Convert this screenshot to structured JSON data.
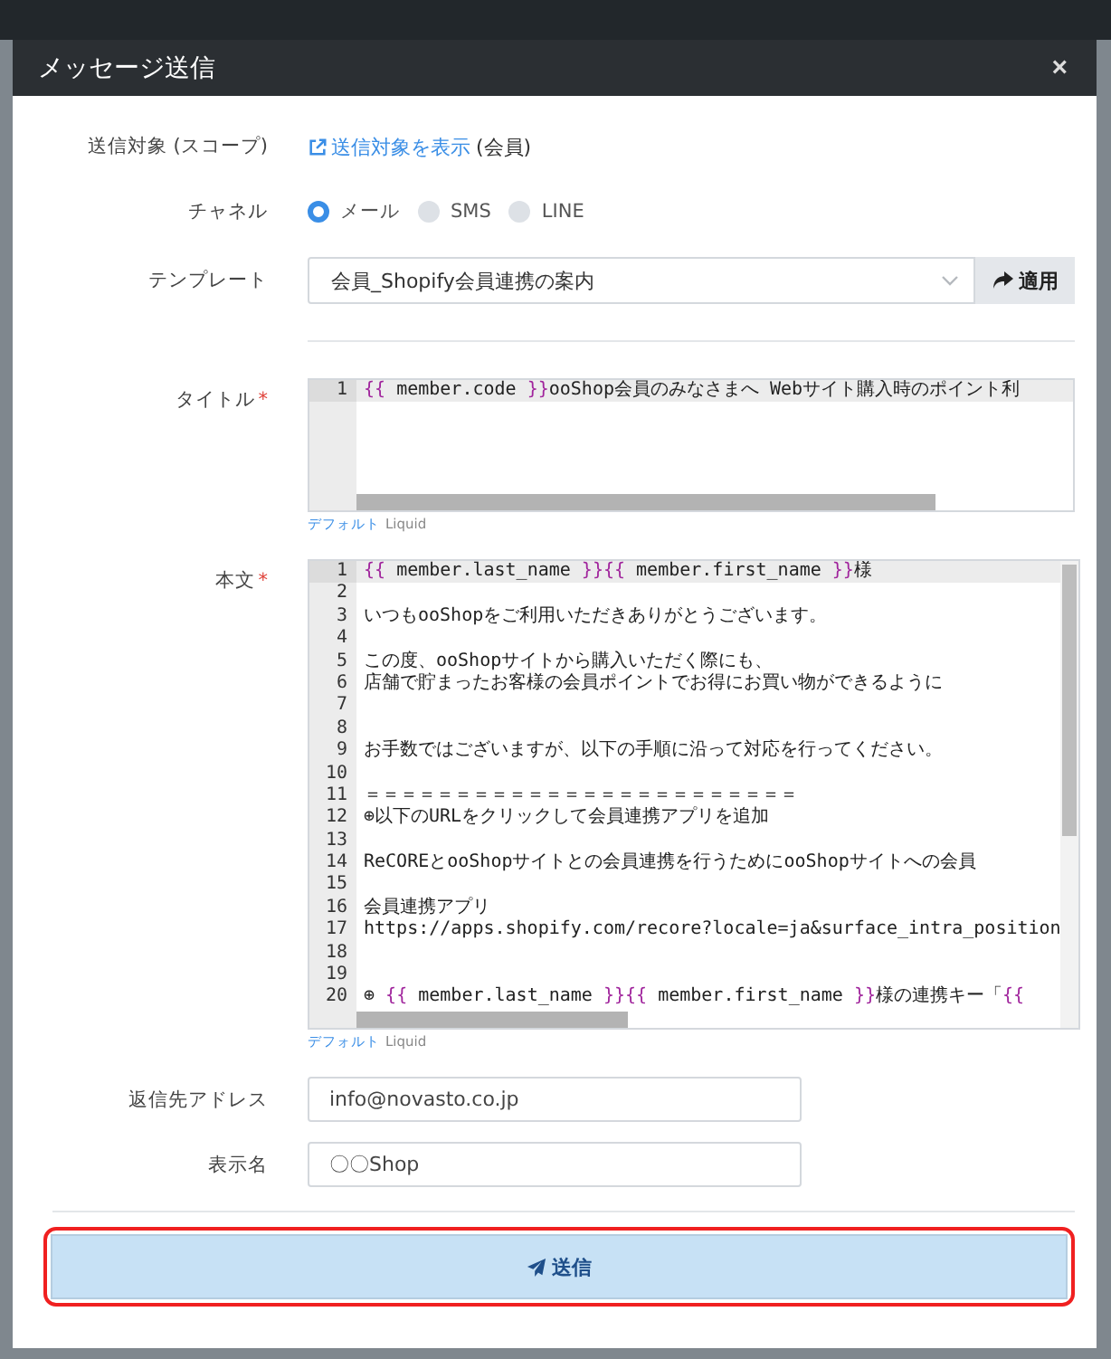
{
  "dialog": {
    "title": "メッセージ送信",
    "close": "×"
  },
  "scope": {
    "label": "送信対象 (スコープ)",
    "link": "送信対象を表示",
    "suffix": "(会員)"
  },
  "channel": {
    "label": "チャネル",
    "options": [
      {
        "label": "メール",
        "selected": true
      },
      {
        "label": "SMS",
        "selected": false
      },
      {
        "label": "LINE",
        "selected": false
      }
    ]
  },
  "template": {
    "label": "テンプレート",
    "value": "会員_Shopify会員連携の案内",
    "apply": "適用"
  },
  "title_editor": {
    "label": "タイトル",
    "required_mark": "*",
    "lines": [
      {
        "number": "1",
        "segments": [
          {
            "kind": "brace",
            "text": "{{"
          },
          {
            "kind": "text",
            "text": " member.code "
          },
          {
            "kind": "brace",
            "text": "}}"
          },
          {
            "kind": "text",
            "text": "ooShop会員のみなさまへ Webサイト購入時のポイント利"
          }
        ]
      }
    ],
    "modes": [
      {
        "kind": "link",
        "label": "デフォルト"
      },
      {
        "kind": "text",
        "label": "Liquid"
      }
    ]
  },
  "body_editor": {
    "label": "本文",
    "required_mark": "*",
    "lines": [
      {
        "number": "1",
        "segments": [
          {
            "kind": "brace",
            "text": "{{"
          },
          {
            "kind": "text",
            "text": " member.last_name "
          },
          {
            "kind": "brace",
            "text": "}}{{"
          },
          {
            "kind": "text",
            "text": " member.first_name "
          },
          {
            "kind": "brace",
            "text": "}}"
          },
          {
            "kind": "text",
            "text": "様"
          }
        ]
      },
      {
        "number": "2"
      },
      {
        "number": "3",
        "segments": [
          {
            "kind": "text",
            "text": "いつもooShopをご利用いただきありがとうございます。"
          }
        ]
      },
      {
        "number": "4"
      },
      {
        "number": "5",
        "segments": [
          {
            "kind": "text",
            "text": "この度、ooShopサイトから購入いただく際にも、"
          }
        ]
      },
      {
        "number": "6",
        "segments": [
          {
            "kind": "text",
            "text": "店舗で貯まったお客様の会員ポイントでお得にお買い物ができるように"
          }
        ]
      },
      {
        "number": "7"
      },
      {
        "number": "8"
      },
      {
        "number": "9",
        "segments": [
          {
            "kind": "text",
            "text": "お手数ではございますが、以下の手順に沿って対応を行ってください。"
          }
        ]
      },
      {
        "number": "10"
      },
      {
        "number": "11",
        "segments": [
          {
            "kind": "text",
            "text": "＝＝＝＝＝＝＝＝＝＝＝＝＝＝＝＝＝＝＝＝＝＝＝＝"
          }
        ]
      },
      {
        "number": "12",
        "segments": [
          {
            "kind": "text",
            "text": "⊕以下のURLをクリックして会員連携アプリを追加"
          }
        ]
      },
      {
        "number": "13"
      },
      {
        "number": "14",
        "segments": [
          {
            "kind": "text",
            "text": "ReCOREとooShopサイトとの会員連携を行うためにooShopサイトへの会員"
          }
        ]
      },
      {
        "number": "15"
      },
      {
        "number": "16",
        "segments": [
          {
            "kind": "text",
            "text": "会員連携アプリ"
          }
        ]
      },
      {
        "number": "17",
        "segments": [
          {
            "kind": "text",
            "text": "https://apps.shopify.com/recore?locale=ja&surface_intra_position"
          }
        ]
      },
      {
        "number": "18"
      },
      {
        "number": "19"
      },
      {
        "number": "20",
        "segments": [
          {
            "kind": "text",
            "text": "⊕ "
          },
          {
            "kind": "brace",
            "text": "{{"
          },
          {
            "kind": "text",
            "text": " member.last_name "
          },
          {
            "kind": "brace",
            "text": "}}{{"
          },
          {
            "kind": "text",
            "text": " member.first_name "
          },
          {
            "kind": "brace",
            "text": "}}"
          },
          {
            "kind": "text",
            "text": "様の連携キー「"
          },
          {
            "kind": "brace",
            "text": "{{"
          }
        ]
      }
    ],
    "modes": [
      {
        "kind": "link",
        "label": "デフォルト"
      },
      {
        "kind": "text",
        "label": "Liquid"
      }
    ]
  },
  "reply_address": {
    "label": "返信先アドレス",
    "value": "info@novasto.co.jp"
  },
  "display_name": {
    "label": "表示名",
    "value": "〇〇Shop"
  },
  "send_button": {
    "label": "送信"
  }
}
